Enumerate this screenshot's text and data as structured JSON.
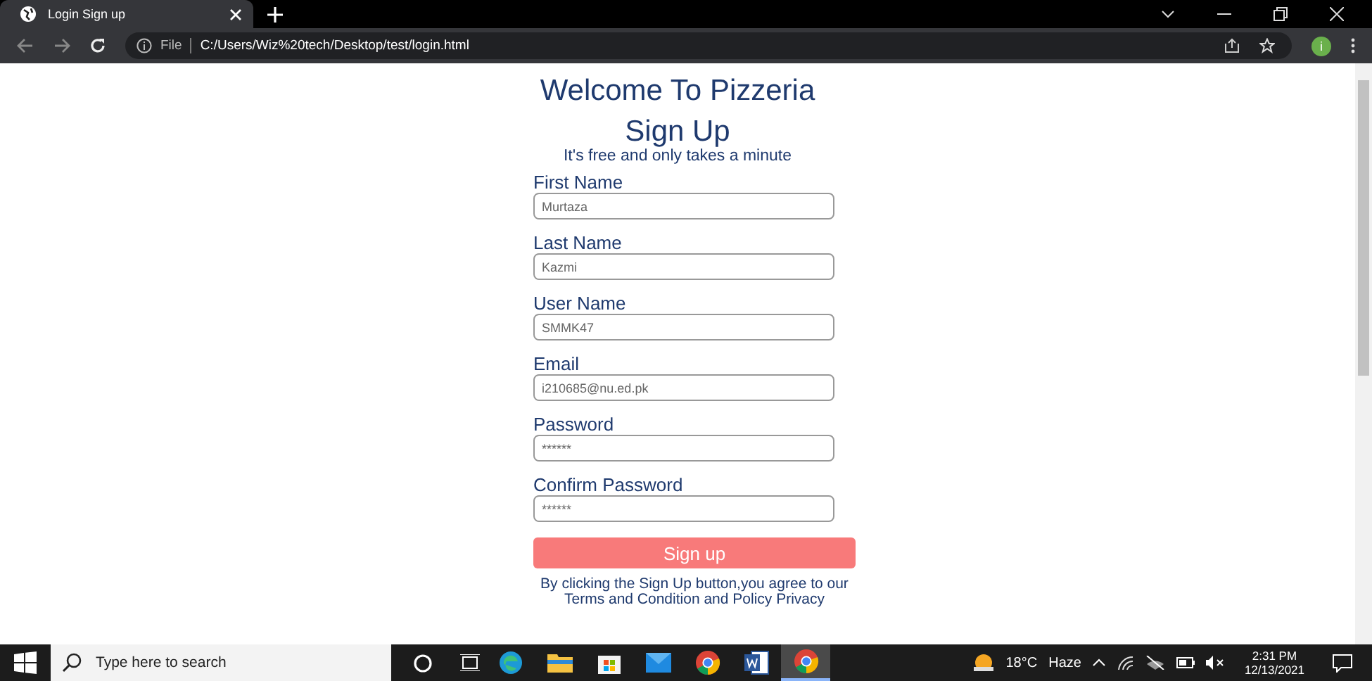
{
  "browser": {
    "tab_title": "Login Sign up",
    "file_label": "File",
    "url": "C:/Users/Wiz%20tech/Desktop/test/login.html",
    "profile_initial": "i"
  },
  "page": {
    "heading": "Welcome To Pizzeria",
    "title": "Sign Up",
    "subtitle": "It's free and only takes a minute",
    "fields": [
      {
        "label": "First Name",
        "value": "Murtaza"
      },
      {
        "label": "Last Name",
        "value": "Kazmi"
      },
      {
        "label": "User Name",
        "value": "SMMK47"
      },
      {
        "label": "Email",
        "value": "i210685@nu.ed.pk"
      },
      {
        "label": "Password",
        "value": "******"
      },
      {
        "label": "Confirm Password",
        "value": "******"
      }
    ],
    "submit": "Sign up",
    "consent": "By clicking the Sign Up button,you agree to our",
    "consent_links": "Terms and Condition and Policy Privacy"
  },
  "taskbar": {
    "search_placeholder": "Type here to search",
    "weather": "18°C",
    "weather_condition": "Haze",
    "time": "2:31 PM",
    "date": "12/13/2021",
    "apps": [
      {
        "kind": "edge",
        "selected": false
      },
      {
        "kind": "explorer",
        "selected": false
      },
      {
        "kind": "store",
        "selected": false
      },
      {
        "kind": "mail",
        "selected": false
      },
      {
        "kind": "chrome",
        "selected": false
      },
      {
        "kind": "word",
        "selected": false
      },
      {
        "kind": "chrome",
        "selected": true
      }
    ]
  }
}
